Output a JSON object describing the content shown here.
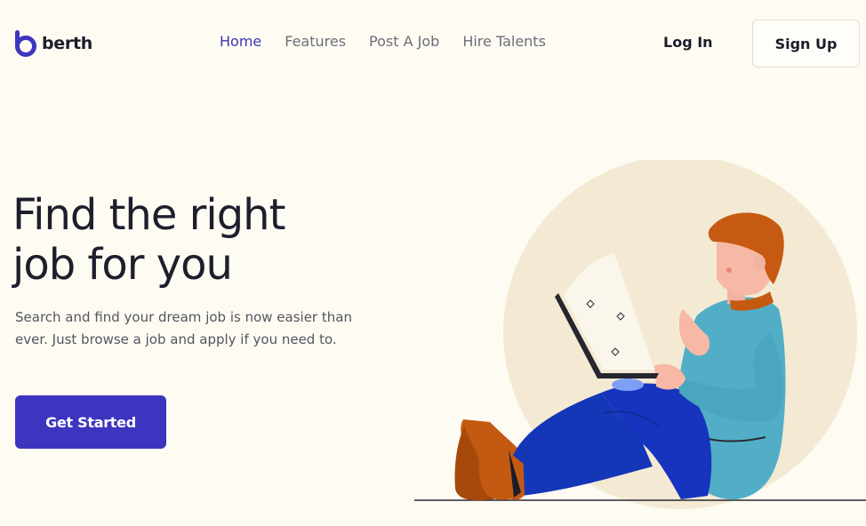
{
  "header": {
    "brand": "berth",
    "nav": [
      {
        "label": "Home",
        "active": true
      },
      {
        "label": "Features",
        "active": false
      },
      {
        "label": "Post A Job",
        "active": false
      },
      {
        "label": "Hire Talents",
        "active": false
      }
    ],
    "login_label": "Log In",
    "signup_label": "Sign Up"
  },
  "hero": {
    "title_line1": "Find the right",
    "title_line2": "job for you",
    "description": "Search and find your dream job is now easier than ever. Just browse a job and apply if you need to.",
    "cta_label": "Get Started"
  },
  "colors": {
    "background": "#fefbf3",
    "accent": "#3d35c0",
    "nav_active": "#3b37b6",
    "circle": "#f4ead4"
  },
  "icons": {
    "logo": "berth-logo-icon",
    "illustration": "person-with-laptop-illustration"
  }
}
